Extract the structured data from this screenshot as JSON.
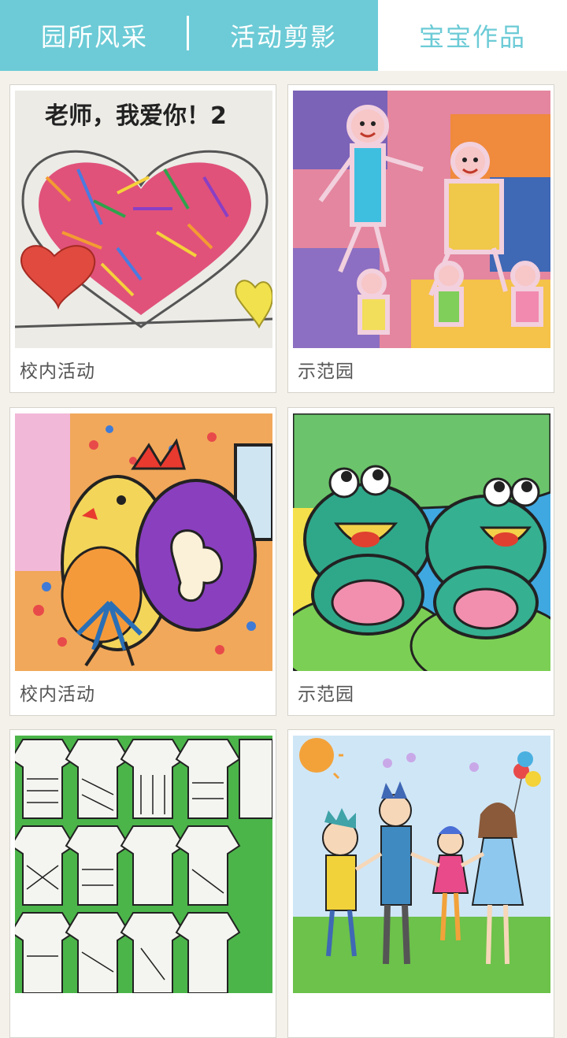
{
  "tabs": [
    {
      "label": "园所风采",
      "active": false
    },
    {
      "label": "活动剪影",
      "active": false
    },
    {
      "label": "宝宝作品",
      "active": true
    }
  ],
  "colors": {
    "accent": "#6ccbd6",
    "background": "#f3f1ea"
  },
  "cards": [
    {
      "caption": "校内活动",
      "art_text": "老师，我爱你！2",
      "image": "heart-collage-artwork"
    },
    {
      "caption": "示范园",
      "image": "paper-people-artwork"
    },
    {
      "caption": "校内活动",
      "image": "rooster-artwork"
    },
    {
      "caption": "示范园",
      "image": "frogs-artwork"
    },
    {
      "caption": "",
      "image": "paper-dresses-artwork"
    },
    {
      "caption": "",
      "image": "family-drawing-artwork"
    }
  ]
}
